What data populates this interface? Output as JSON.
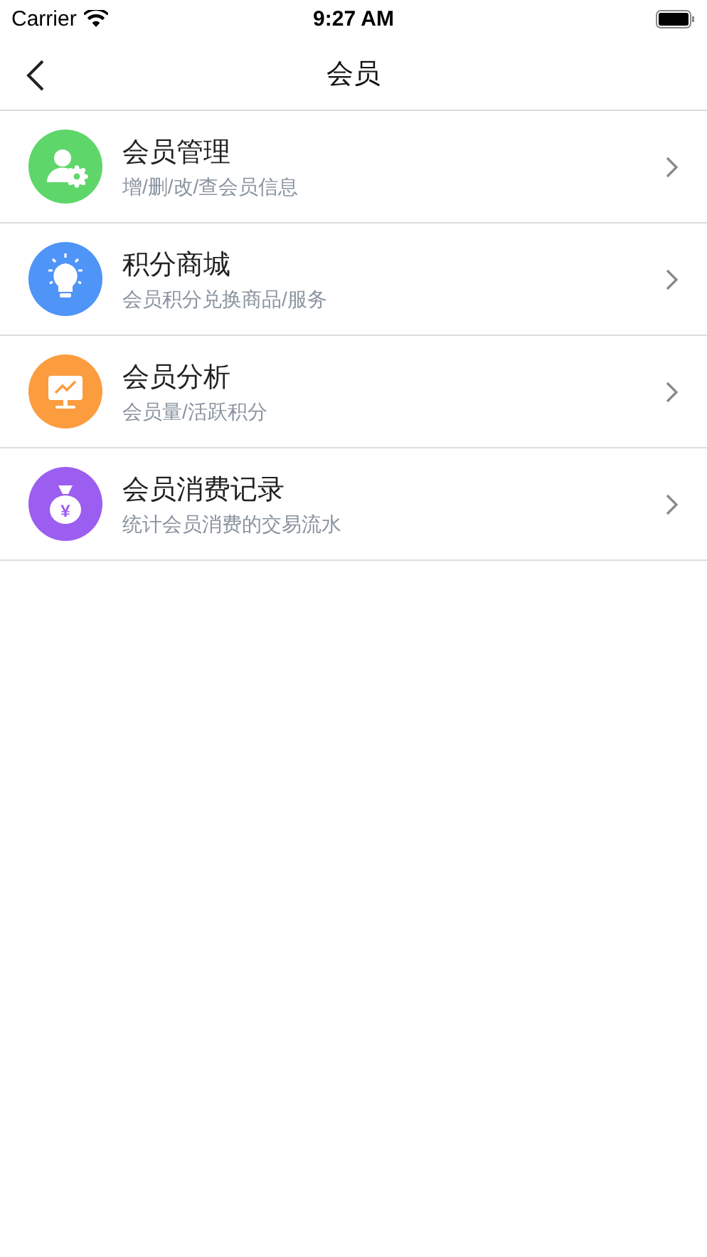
{
  "status_bar": {
    "carrier": "Carrier",
    "time": "9:27 AM"
  },
  "nav": {
    "title": "会员"
  },
  "items": [
    {
      "kind": "member",
      "title": "会员管理",
      "subtitle": "增/删/改/查会员信息",
      "color": "#5fd66a"
    },
    {
      "kind": "bulb",
      "title": "积分商城",
      "subtitle": "会员积分兑换商品/服务",
      "color": "#4f94f7"
    },
    {
      "kind": "monitor",
      "title": "会员分析",
      "subtitle": "会员量/活跃积分",
      "color": "#fb9d3f"
    },
    {
      "kind": "moneybag",
      "title": "会员消费记录",
      "subtitle": "统计会员消费的交易流水",
      "color": "#9c5ef0",
      "symbol": "¥"
    }
  ]
}
